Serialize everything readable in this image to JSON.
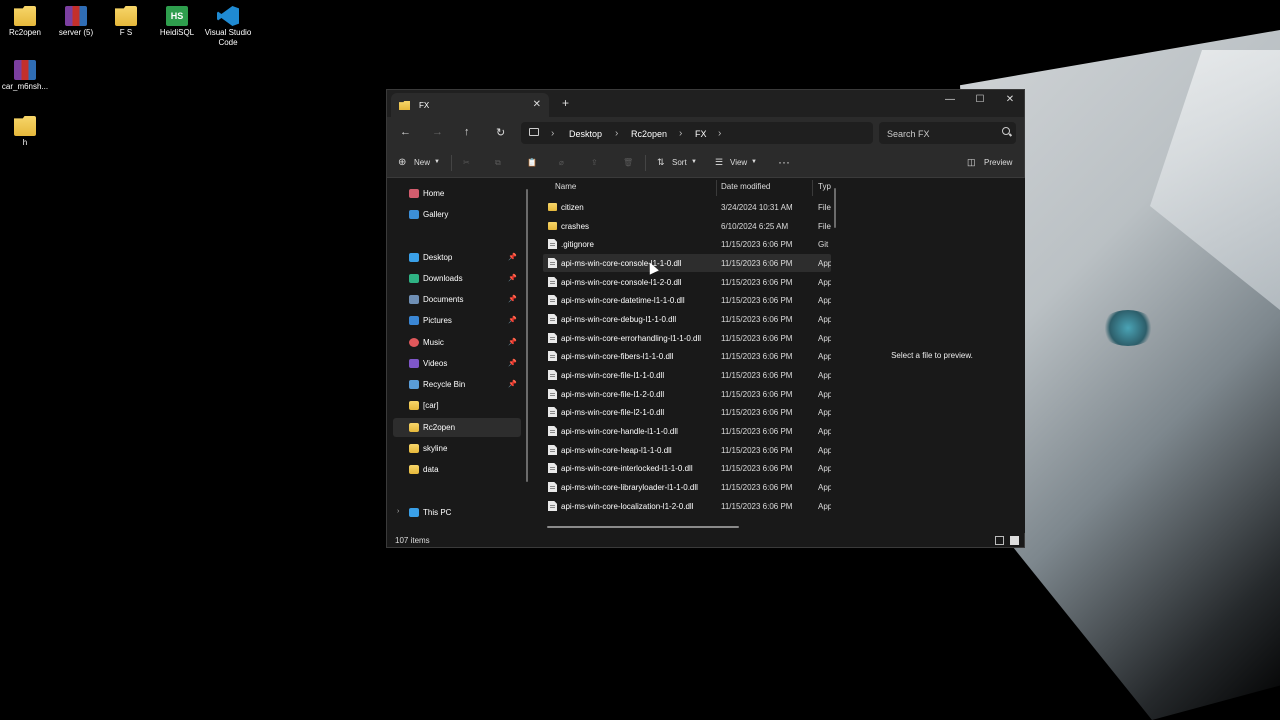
{
  "desktop": {
    "icons": [
      {
        "label": "Rc2open",
        "icon": "folder-icon"
      },
      {
        "label": "server (5)",
        "icon": "rar-archive-icon"
      },
      {
        "label": "F S",
        "icon": "folder-icon"
      },
      {
        "label": "HeidiSQL",
        "icon": "heidisql-icon",
        "glyph_text": "HS"
      },
      {
        "label": "Visual Studio Code",
        "icon": "vscode-icon"
      },
      {
        "label": "car_m6nsh...",
        "icon": "rar-archive-icon"
      },
      {
        "label": "h",
        "icon": "folder-icon"
      }
    ]
  },
  "window": {
    "tab_title": "FX",
    "tab_close": "✕",
    "new_tab": "+",
    "controls": {
      "minimize": "—",
      "maximize": "☐",
      "close": "✕"
    },
    "nav": {
      "back": "←",
      "forward": "→",
      "up": "↑",
      "refresh": "↻"
    },
    "breadcrumb": [
      "Desktop",
      "Rc2open",
      "FX"
    ],
    "search_placeholder": "Search FX",
    "toolbar": {
      "new_label": "New",
      "sort_label": "Sort",
      "view_label": "View",
      "more_label": "···",
      "preview_label": "Preview",
      "icons": {
        "cut": "✂",
        "copy": "⧉",
        "paste": "📋",
        "rename": "⌀",
        "share": "⇪",
        "delete": "🗑"
      }
    },
    "sidebar": {
      "items": [
        {
          "label": "Home",
          "icon": "home-icon",
          "pinned": false
        },
        {
          "label": "Gallery",
          "icon": "gallery-icon",
          "pinned": false
        },
        {
          "label": "Desktop",
          "icon": "desktop-icon",
          "pinned": true
        },
        {
          "label": "Downloads",
          "icon": "downloads-icon",
          "pinned": true
        },
        {
          "label": "Documents",
          "icon": "documents-icon",
          "pinned": true
        },
        {
          "label": "Pictures",
          "icon": "pictures-icon",
          "pinned": true
        },
        {
          "label": "Music",
          "icon": "music-icon",
          "pinned": true
        },
        {
          "label": "Videos",
          "icon": "videos-icon",
          "pinned": true
        },
        {
          "label": "Recycle Bin",
          "icon": "recycle-bin-icon",
          "pinned": true
        },
        {
          "label": "[car]",
          "icon": "folder-icon",
          "pinned": false
        },
        {
          "label": "Rc2open",
          "icon": "folder-icon",
          "pinned": false,
          "selected": true
        },
        {
          "label": "skyline",
          "icon": "folder-icon",
          "pinned": false
        },
        {
          "label": "data",
          "icon": "folder-icon",
          "pinned": false
        },
        {
          "label": "This PC",
          "icon": "this-pc-icon",
          "pinned": false,
          "expandable": true
        }
      ],
      "pin_glyph": "📌",
      "chevron_glyph": "›"
    },
    "columns": {
      "name": "Name",
      "date_modified": "Date modified",
      "type": "Typ"
    },
    "files": [
      {
        "name": "citizen",
        "date": "3/24/2024 10:31 AM",
        "type": "File",
        "kind": "folder"
      },
      {
        "name": "crashes",
        "date": "6/10/2024 6:25 AM",
        "type": "File",
        "kind": "folder"
      },
      {
        "name": ".gitignore",
        "date": "11/15/2023 6:06 PM",
        "type": "Git I",
        "kind": "file"
      },
      {
        "name": "api-ms-win-core-console-l1-1-0.dll",
        "date": "11/15/2023 6:06 PM",
        "type": "App",
        "kind": "file",
        "hovered": true
      },
      {
        "name": "api-ms-win-core-console-l1-2-0.dll",
        "date": "11/15/2023 6:06 PM",
        "type": "App",
        "kind": "file"
      },
      {
        "name": "api-ms-win-core-datetime-l1-1-0.dll",
        "date": "11/15/2023 6:06 PM",
        "type": "App",
        "kind": "file"
      },
      {
        "name": "api-ms-win-core-debug-l1-1-0.dll",
        "date": "11/15/2023 6:06 PM",
        "type": "App",
        "kind": "file"
      },
      {
        "name": "api-ms-win-core-errorhandling-l1-1-0.dll",
        "date": "11/15/2023 6:06 PM",
        "type": "App",
        "kind": "file"
      },
      {
        "name": "api-ms-win-core-fibers-l1-1-0.dll",
        "date": "11/15/2023 6:06 PM",
        "type": "App",
        "kind": "file"
      },
      {
        "name": "api-ms-win-core-file-l1-1-0.dll",
        "date": "11/15/2023 6:06 PM",
        "type": "App",
        "kind": "file"
      },
      {
        "name": "api-ms-win-core-file-l1-2-0.dll",
        "date": "11/15/2023 6:06 PM",
        "type": "App",
        "kind": "file"
      },
      {
        "name": "api-ms-win-core-file-l2-1-0.dll",
        "date": "11/15/2023 6:06 PM",
        "type": "App",
        "kind": "file"
      },
      {
        "name": "api-ms-win-core-handle-l1-1-0.dll",
        "date": "11/15/2023 6:06 PM",
        "type": "App",
        "kind": "file"
      },
      {
        "name": "api-ms-win-core-heap-l1-1-0.dll",
        "date": "11/15/2023 6:06 PM",
        "type": "App",
        "kind": "file"
      },
      {
        "name": "api-ms-win-core-interlocked-l1-1-0.dll",
        "date": "11/15/2023 6:06 PM",
        "type": "App",
        "kind": "file"
      },
      {
        "name": "api-ms-win-core-libraryloader-l1-1-0.dll",
        "date": "11/15/2023 6:06 PM",
        "type": "App",
        "kind": "file"
      },
      {
        "name": "api-ms-win-core-localization-l1-2-0.dll",
        "date": "11/15/2023 6:06 PM",
        "type": "App",
        "kind": "file"
      }
    ],
    "preview_message": "Select a file to preview.",
    "status": {
      "item_count": "107 items"
    }
  }
}
